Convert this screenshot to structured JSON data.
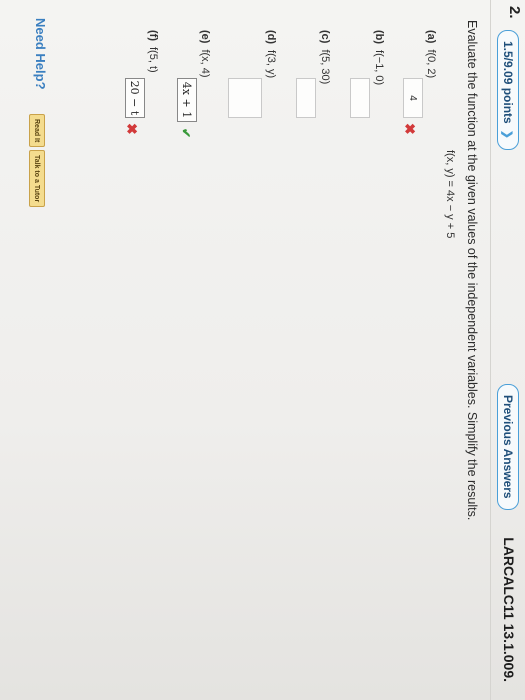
{
  "header": {
    "question_number": "2.",
    "points": "1.5/9.09 points",
    "previous_answers": "Previous Answers",
    "reference": "LARCALC11 13.1.009."
  },
  "question": {
    "instruction": "Evaluate the function at the given values of the independent variables. Simplify the results.",
    "function": "f(x, y) = 4x − y + 5",
    "parts": [
      {
        "label": "(a)",
        "expr": "f(0, 2)",
        "answer": "4",
        "status": "incorrect"
      },
      {
        "label": "(b)",
        "expr": "f(−1, 0)",
        "answer": "",
        "status": ""
      },
      {
        "label": "(c)",
        "expr": "f(5, 30)",
        "answer": "",
        "status": ""
      },
      {
        "label": "(d)",
        "expr": "f(3, y)",
        "answer": "",
        "status": ""
      },
      {
        "label": "(e)",
        "expr": "f(x, 4)",
        "answer": "4x + 1",
        "status": "correct"
      },
      {
        "label": "(f)",
        "expr": "f(5, t)",
        "answer": "20 − t",
        "status": "incorrect"
      }
    ]
  },
  "footer": {
    "need_help": "Need Help?",
    "read_it": "Read It",
    "talk_to_tutor": "Talk to a Tutor"
  },
  "marks": {
    "incorrect_glyph": "✖",
    "correct_glyph": "✔"
  }
}
